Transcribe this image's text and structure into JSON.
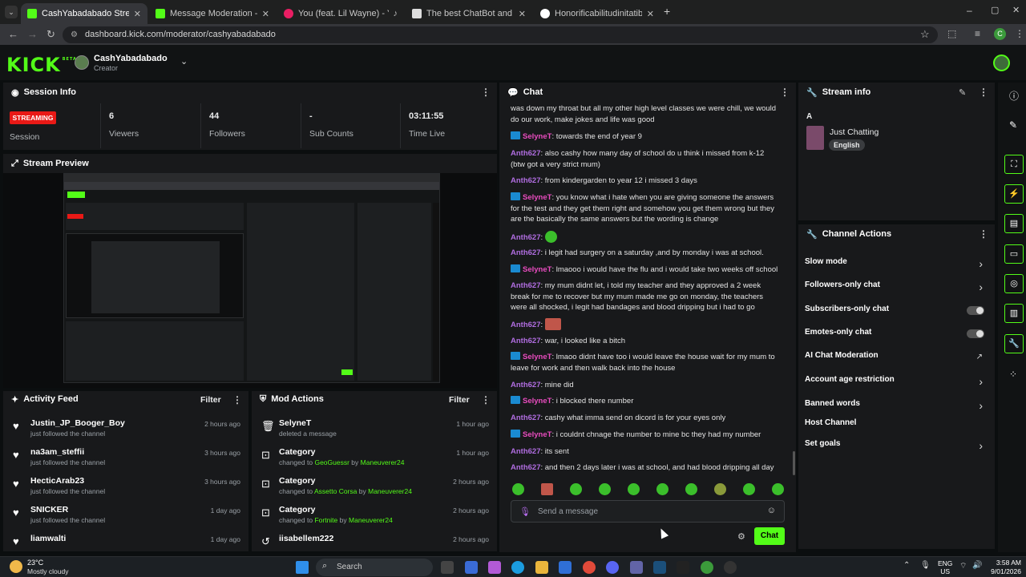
{
  "browser": {
    "tabs": [
      {
        "label": "CashYabadabado Stream - Kick",
        "active": true
      },
      {
        "label": "Message Moderation - Kick Da"
      },
      {
        "label": "You (feat. Lil Wayne) - YouT"
      },
      {
        "label": "The best ChatBot and Widgets"
      },
      {
        "label": "Honorificabilitudinitatibus - Go"
      }
    ],
    "url": "dashboard.kick.com/moderator/cashyabadabado"
  },
  "header": {
    "logo": "KICK",
    "logo_tag": "BETA",
    "channel_name": "CashYabadabado",
    "channel_role": "Creator"
  },
  "session": {
    "title": "Session Info",
    "status_badge": "STREAMING",
    "status_label": "Session",
    "stats": [
      {
        "value": "6",
        "label": "Viewers"
      },
      {
        "value": "44",
        "label": "Followers"
      },
      {
        "value": "-",
        "label": "Sub Counts"
      },
      {
        "value": "03:11:55",
        "label": "Time Live"
      }
    ]
  },
  "preview": {
    "title": "Stream Preview"
  },
  "activity": {
    "title": "Activity Feed",
    "filter": "Filter",
    "items": [
      {
        "name": "Justin_JP_Booger_Boy",
        "sub": "just followed the channel",
        "time": "2 hours ago"
      },
      {
        "name": "na3am_steffii",
        "sub": "just followed the channel",
        "time": "3 hours ago"
      },
      {
        "name": "HecticArab23",
        "sub": "just followed the channel",
        "time": "3 hours ago"
      },
      {
        "name": "SNICKER",
        "sub": "just followed the channel",
        "time": "1 day ago"
      },
      {
        "name": "liamwalti",
        "sub": "",
        "time": "1 day ago"
      }
    ]
  },
  "mod": {
    "title": "Mod Actions",
    "filter": "Filter",
    "items": [
      {
        "name": "SelyneT",
        "sub": "deleted a message",
        "time": "1 hour ago"
      },
      {
        "name": "Category",
        "pre": "changed to",
        "game": "GeoGuessr",
        "by": "by",
        "user": "Maneuverer24",
        "time": "1 hour ago"
      },
      {
        "name": "Category",
        "pre": "changed to",
        "game": "Assetto Corsa",
        "by": "by",
        "user": "Maneuverer24",
        "time": "2 hours ago"
      },
      {
        "name": "Category",
        "pre": "changed to",
        "game": "Fortnite",
        "by": "by",
        "user": "Maneuverer24",
        "time": "2 hours ago"
      },
      {
        "name": "iisabellem222",
        "sub": "",
        "time": "2 hours ago"
      }
    ]
  },
  "chat": {
    "title": "Chat",
    "messages": [
      {
        "user": "",
        "text": "was down my throat but all my other high level classes we were chill, we would do our work, make jokes and life was good"
      },
      {
        "user": "SelyneT",
        "text": ": towards the end of year 9"
      },
      {
        "user": "Anth627",
        "text": ": also cashy how many day of school do u think i missed from k-12 (btw got a very strict mum)"
      },
      {
        "user": "Anth627",
        "text": ": from kindergarden to year 12 i missed 3 days"
      },
      {
        "user": "SelyneT",
        "text": ": you know what i hate when you are giving someone the answers for the test and they get them right and somehow you get them wrong but they are the basically the same answers but the wording is change"
      },
      {
        "user": "Anth627",
        "text": ":"
      },
      {
        "user": "Anth627",
        "text": ": i legit had surgery on a saturday ,and by monday i was at school."
      },
      {
        "user": "SelyneT",
        "text": ": lmaooo i would have the flu and i would take two weeks off school"
      },
      {
        "user": "Anth627",
        "text": ": my mum didnt let, i told my teacher and they approved a 2 week break for me to recover but my mum made me go on monday, the teachers were all shocked, i legit had bandages and blood dripping but i had to go"
      },
      {
        "user": "Anth627",
        "text": ":"
      },
      {
        "user": "Anth627",
        "text": ": war, i looked like a bitch"
      },
      {
        "user": "SelyneT",
        "text": ": lmaoo didnt have too i would leave the house wait for my mum to leave for work and then walk back into the house"
      },
      {
        "user": "Anth627",
        "text": ": mine did"
      },
      {
        "user": "SelyneT",
        "text": ": i blocked there number"
      },
      {
        "user": "Anth627",
        "text": ": cashy what imma send on dicord is for your eyes only"
      },
      {
        "user": "SelyneT",
        "text": ": i couldnt chnage the number to mine bc they had my number"
      },
      {
        "user": "Anth627",
        "text": ": its sent"
      },
      {
        "user": "Anth627",
        "text": ": and then 2 days later i was at school, and had blood dripping all day"
      }
    ],
    "input_placeholder": "Send a message",
    "send_label": "Chat"
  },
  "stream_info": {
    "title": "Stream info",
    "letter": "A",
    "category": "Just Chatting",
    "language": "English"
  },
  "channel_actions": {
    "title": "Channel Actions",
    "items": [
      {
        "label": "Slow mode",
        "control": "chevron"
      },
      {
        "label": "Followers-only chat",
        "control": "chevron"
      },
      {
        "label": "Subscribers-only chat",
        "control": "toggle"
      },
      {
        "label": "Emotes-only chat",
        "control": "toggle"
      },
      {
        "label": "AI Chat Moderation",
        "control": "external"
      },
      {
        "label": "Account age restriction",
        "control": "chevron"
      },
      {
        "label": "Banned words",
        "control": "chevron"
      },
      {
        "label": "Host Channel",
        "control": "none"
      },
      {
        "label": "Set goals",
        "control": "chevron"
      }
    ]
  },
  "taskbar": {
    "temp": "23°C",
    "weather": "Mostly cloudy",
    "search": "Search",
    "lang": "ENG",
    "region": "US",
    "time": "3:58 AM",
    "date": "9/01/2026"
  },
  "colors": {
    "accent": "#53fc18",
    "panel": "#18191b",
    "badge": "#e91916"
  }
}
